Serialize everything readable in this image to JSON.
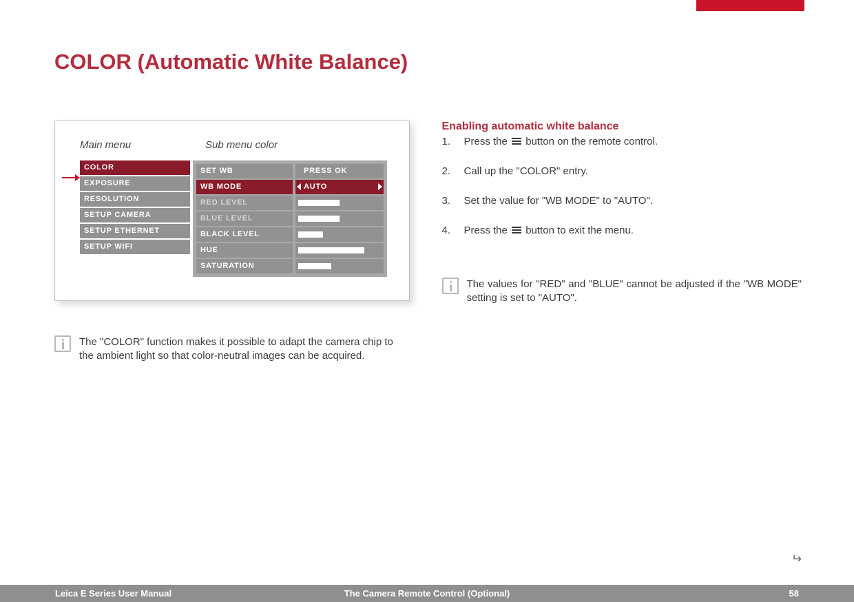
{
  "header": {
    "title": "COLOR (Automatic White Balance)"
  },
  "diagram": {
    "main_label": "Main menu",
    "sub_label": "Sub menu color",
    "main_menu": [
      "COLOR",
      "EXPOSURE",
      "RESOLUTION",
      "SETUP CAMERA",
      "SETUP ETHERNET",
      "SETUP WIFI"
    ],
    "sub_menu": [
      {
        "label": "SET WB",
        "dim": false
      },
      {
        "label": "WB MODE",
        "dim": false,
        "selected": true
      },
      {
        "label": "RED LEVEL",
        "dim": true
      },
      {
        "label": "BLUE LEVEL",
        "dim": true
      },
      {
        "label": "BLACK LEVEL",
        "dim": false
      },
      {
        "label": "HUE",
        "dim": false
      },
      {
        "label": "SATURATION",
        "dim": false
      }
    ],
    "values": {
      "press_ok": "PRESS OK",
      "auto": "AUTO",
      "sliders": [
        50,
        50,
        30,
        80,
        40
      ]
    }
  },
  "left_info": "The \"COLOR\" function makes it possible to adapt the camera chip to the ambient light so that color-neutral images can be acquired.",
  "right": {
    "heading": "Enabling automatic white balance",
    "steps": [
      {
        "n": "1.",
        "pre": "Press the ",
        "post": " button on the remote control.",
        "icon": true
      },
      {
        "n": "2.",
        "pre": "Call up the \"COLOR\" entry.",
        "post": "",
        "icon": false
      },
      {
        "n": "3.",
        "pre": "Set the value for \"WB MODE\" to \"AUTO\".",
        "post": "",
        "icon": false
      },
      {
        "n": "4.",
        "pre": "Press the ",
        "post": " button to exit the menu.",
        "icon": true
      }
    ],
    "note": "The values for \"RED\" and \"BLUE\" cannot be adjusted if the \"WB MODE\" setting is set to \"AUTO\"."
  },
  "footer": {
    "left": "Leica E Series User Manual",
    "center": "The Camera Remote Control (Optional)",
    "page": "58"
  }
}
